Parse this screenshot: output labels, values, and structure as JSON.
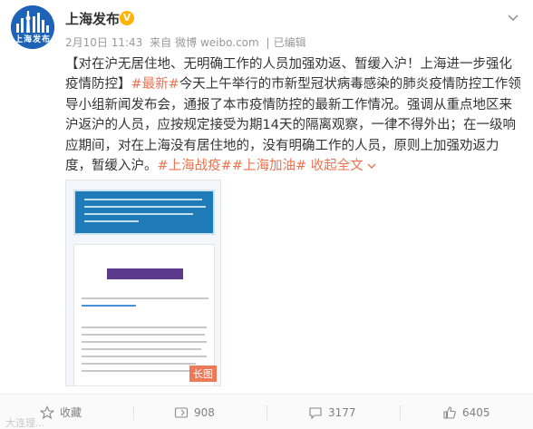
{
  "account": {
    "name": "上海发布",
    "avatar_text": "上海发布",
    "verified_mark": "V"
  },
  "meta": {
    "date": "2月10日",
    "time": "11:43",
    "source_prefix": "来自",
    "source": "微博 weibo.com",
    "edited": "已编辑"
  },
  "post": {
    "headline": "【对在沪无居住地、无明确工作的人员加强劝返、暂缓入沪！上海进一步强化疫情防控】",
    "latest_link": "#最新#",
    "body": "今天上午举行的市新型冠状病毒感染的肺炎疫情防控工作领导小组新闻发布会，通报了本市疫情防控的最新工作情况。强调从重点地区来沪返沪的人员，应按规定接受为期14天的隔离观察，一律不得外出；在一级响应期间，对在上海没有居住地的，没有明确工作的人员，原则上加强劝返力度，暂缓入沪。",
    "tag1": "#上海战疫#",
    "tag2": "#上海加油#",
    "collapse_label": "收起全文"
  },
  "image": {
    "long_badge": "长图"
  },
  "actions": {
    "favorite_label": "收藏",
    "repost_count": "908",
    "comment_count": "3177",
    "like_count": "6405"
  },
  "watermark": "大连理..."
}
